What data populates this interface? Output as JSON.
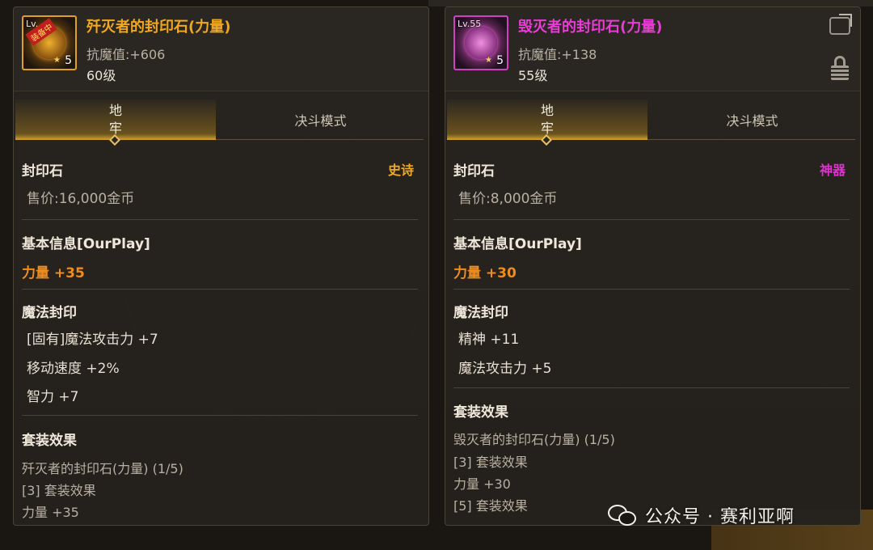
{
  "left_item": {
    "title": "歼灭者的封印石(力量)",
    "resist": "抗魔值:+606",
    "level": "60级",
    "icon": {
      "lv": "Lv.",
      "count": "5",
      "ribbon": "装备中",
      "name": "seal-stone-orange-icon"
    },
    "tabs": {
      "active_label": [
        "地",
        "牢"
      ],
      "inactive_label": "决斗模式"
    },
    "category": "封印石",
    "rarity": "史诗",
    "price": "售价:16,000金币",
    "basic_title": "基本信息[OurPlay]",
    "basic_stat": "力量 +35",
    "magic_title": "魔法封印",
    "magic_lines": [
      "[固有]魔法攻击力 +7",
      "移动速度 +2%",
      "智力 +7"
    ],
    "set_title": "套装效果",
    "set_lines": [
      "歼灭者的封印石(力量) (1/5)",
      "[3] 套装效果",
      "力量 +35"
    ]
  },
  "right_item": {
    "title": "毁灭者的封印石(力量)",
    "resist": "抗魔值:+138",
    "level": "55级",
    "icon": {
      "lv": "Lv.55",
      "count": "5",
      "name": "seal-stone-purple-icon"
    },
    "tabs": {
      "active_label": [
        "地",
        "牢"
      ],
      "inactive_label": "决斗模式"
    },
    "category": "封印石",
    "rarity": "神器",
    "price": "售价:8,000金币",
    "basic_title": "基本信息[OurPlay]",
    "basic_stat": "力量 +30",
    "magic_title": "魔法封印",
    "magic_lines": [
      "精神 +11",
      "魔法攻击力 +5"
    ],
    "set_title": "套装效果",
    "set_lines": [
      "毁灭者的封印石(力量) (1/5)",
      "[3] 套装效果",
      "力量 +30",
      "[5] 套装效果"
    ]
  },
  "watermark": "公众号 · 赛利亚啊",
  "colors": {
    "epic": "#f2a81c",
    "artifact": "#e030d0",
    "stat": "#f08c1c",
    "tab_accent": "#d4a22a"
  }
}
